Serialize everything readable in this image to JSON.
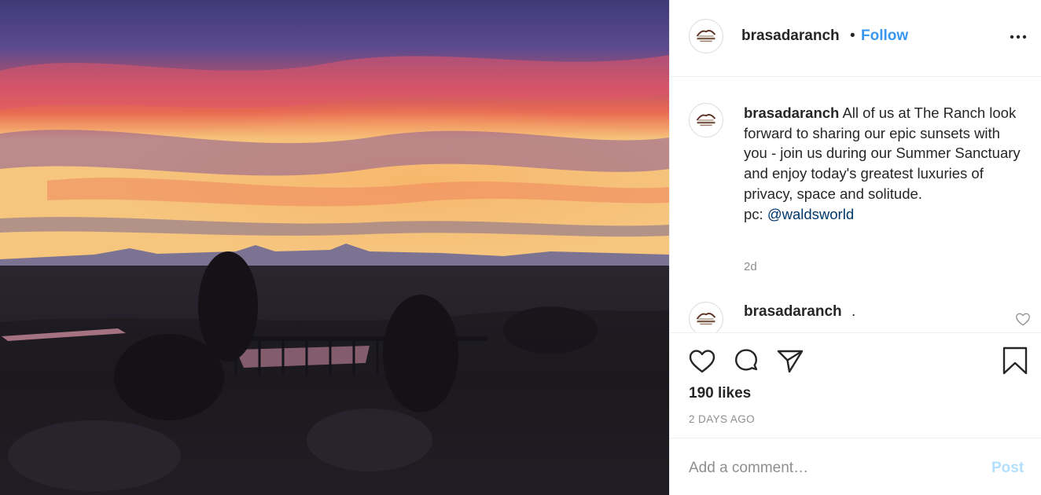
{
  "post": {
    "photo_description_icon": "sunset-photo",
    "username": "brasadaranch",
    "separator": "•",
    "follow_label": "Follow",
    "more_icon": "more-horizontal-icon"
  },
  "caption": {
    "username": "brasadaranch",
    "text": " All of us at The Ranch look forward to sharing our epic sunsets with you - join us during our Summer Sanctuary and enjoy today's greatest luxuries of privacy, space and solitude.",
    "pc_prefix": "pc: ",
    "mention": "@waldsworld",
    "time": "2d"
  },
  "comment2": {
    "username": "brasadaranch",
    "text": "."
  },
  "actions": {
    "likes": "190 likes",
    "posted": "2 DAYS AGO"
  },
  "add_comment": {
    "placeholder": "Add a comment…",
    "post_label": "Post"
  },
  "colors": {
    "follow": "#3897f0",
    "mention": "#00376b",
    "post_disabled": "#b2dffc",
    "muted": "#8e8e8e"
  }
}
